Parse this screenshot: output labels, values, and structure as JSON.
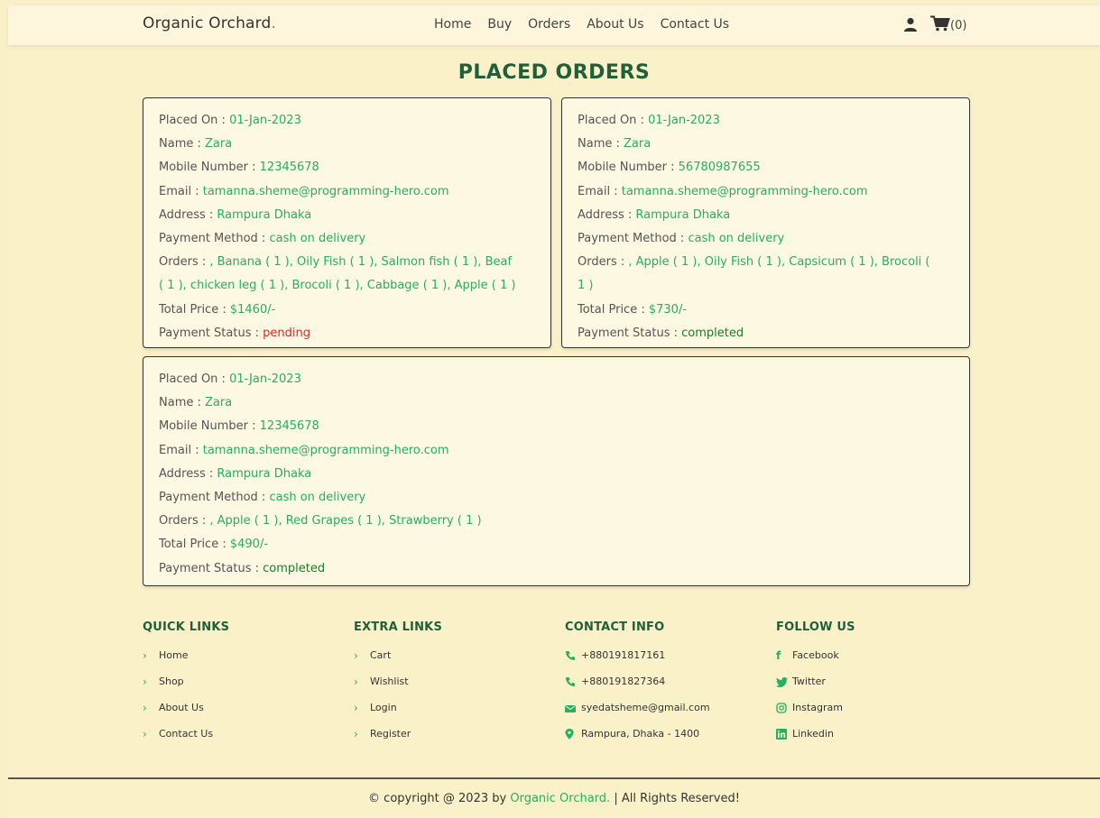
{
  "header": {
    "logo_text": "Organic Orchard",
    "logo_dot": ".",
    "nav": [
      "Home",
      "Buy",
      "Orders",
      "About Us",
      "Contact Us"
    ],
    "cart_count": "(0)",
    "icons": [
      "user-icon",
      "cart-icon"
    ]
  },
  "page_title": "PLACED ORDERS",
  "labels": {
    "placed_on": "Placed On : ",
    "name": "Name : ",
    "mobile": "Mobile Number : ",
    "email": "Email : ",
    "address": "Address : ",
    "payment_method": "Payment Method : ",
    "orders": "Orders : ",
    "total_price": "Total Price : ",
    "payment_status": "Payment Status : "
  },
  "orders": [
    {
      "placed_on": "01-Jan-2023",
      "name": "Zara",
      "mobile": "12345678",
      "email": "tamanna.sheme@programming-hero.com",
      "address": "Rampura Dhaka",
      "payment_method": "cash on delivery",
      "items_line1": ", Banana ( 1 ), Oily Fish ( 1 ), Salmon fish ( 1 ), Beaf",
      "items_line2": "( 1 ), chicken leg ( 1 ), Brocoli ( 1 ), Cabbage ( 1 ), Apple ( 1 )",
      "total_price": "$1460/-",
      "payment_status": "pending"
    },
    {
      "placed_on": "01-Jan-2023",
      "name": "Zara",
      "mobile": "56780987655",
      "email": "tamanna.sheme@programming-hero.com",
      "address": "Rampura Dhaka",
      "payment_method": "cash on delivery",
      "items_line1": ", Apple ( 1 ), Oily Fish ( 1 ), Capsicum ( 1 ), Brocoli (",
      "items_line2": "1 )",
      "total_price": "$730/-",
      "payment_status": "completed"
    },
    {
      "placed_on": "01-Jan-2023",
      "name": "Zara",
      "mobile": "12345678",
      "email": "tamanna.sheme@programming-hero.com",
      "address": "Rampura Dhaka",
      "payment_method": "cash on delivery",
      "items_line1": ", Apple ( 1 ), Red Grapes ( 1 ), Strawberry ( 1 )",
      "items_line2": "",
      "total_price": "$490/-",
      "payment_status": "completed"
    }
  ],
  "footer": {
    "quick_links": {
      "title": "QUICK LINKS",
      "items": [
        "Home",
        "Shop",
        "About Us",
        "Contact Us"
      ]
    },
    "extra_links": {
      "title": "EXTRA LINKS",
      "items": [
        "Cart",
        "Wishlist",
        "Login",
        "Register"
      ]
    },
    "contact_info": {
      "title": "CONTACT INFO",
      "items": [
        "+880191817161",
        "+880191827364",
        "syedatsheme@gmail.com",
        "Rampura, Dhaka - 1400"
      ]
    },
    "follow_us": {
      "title": "FOLLOW US",
      "items": [
        "Facebook",
        "Twitter",
        "Instagram",
        "Linkedin"
      ]
    },
    "copyright_prefix": "© copyright @ 2023 by ",
    "copyright_brand": "Organic Orchard.",
    "copyright_suffix": " | All Rights Reserved!"
  },
  "colors": {
    "accent": "#27ae60",
    "title": "#1f5f3a",
    "pending": "#e0262a",
    "completed": "#1c7d2c",
    "background": "#fbf1c9"
  }
}
